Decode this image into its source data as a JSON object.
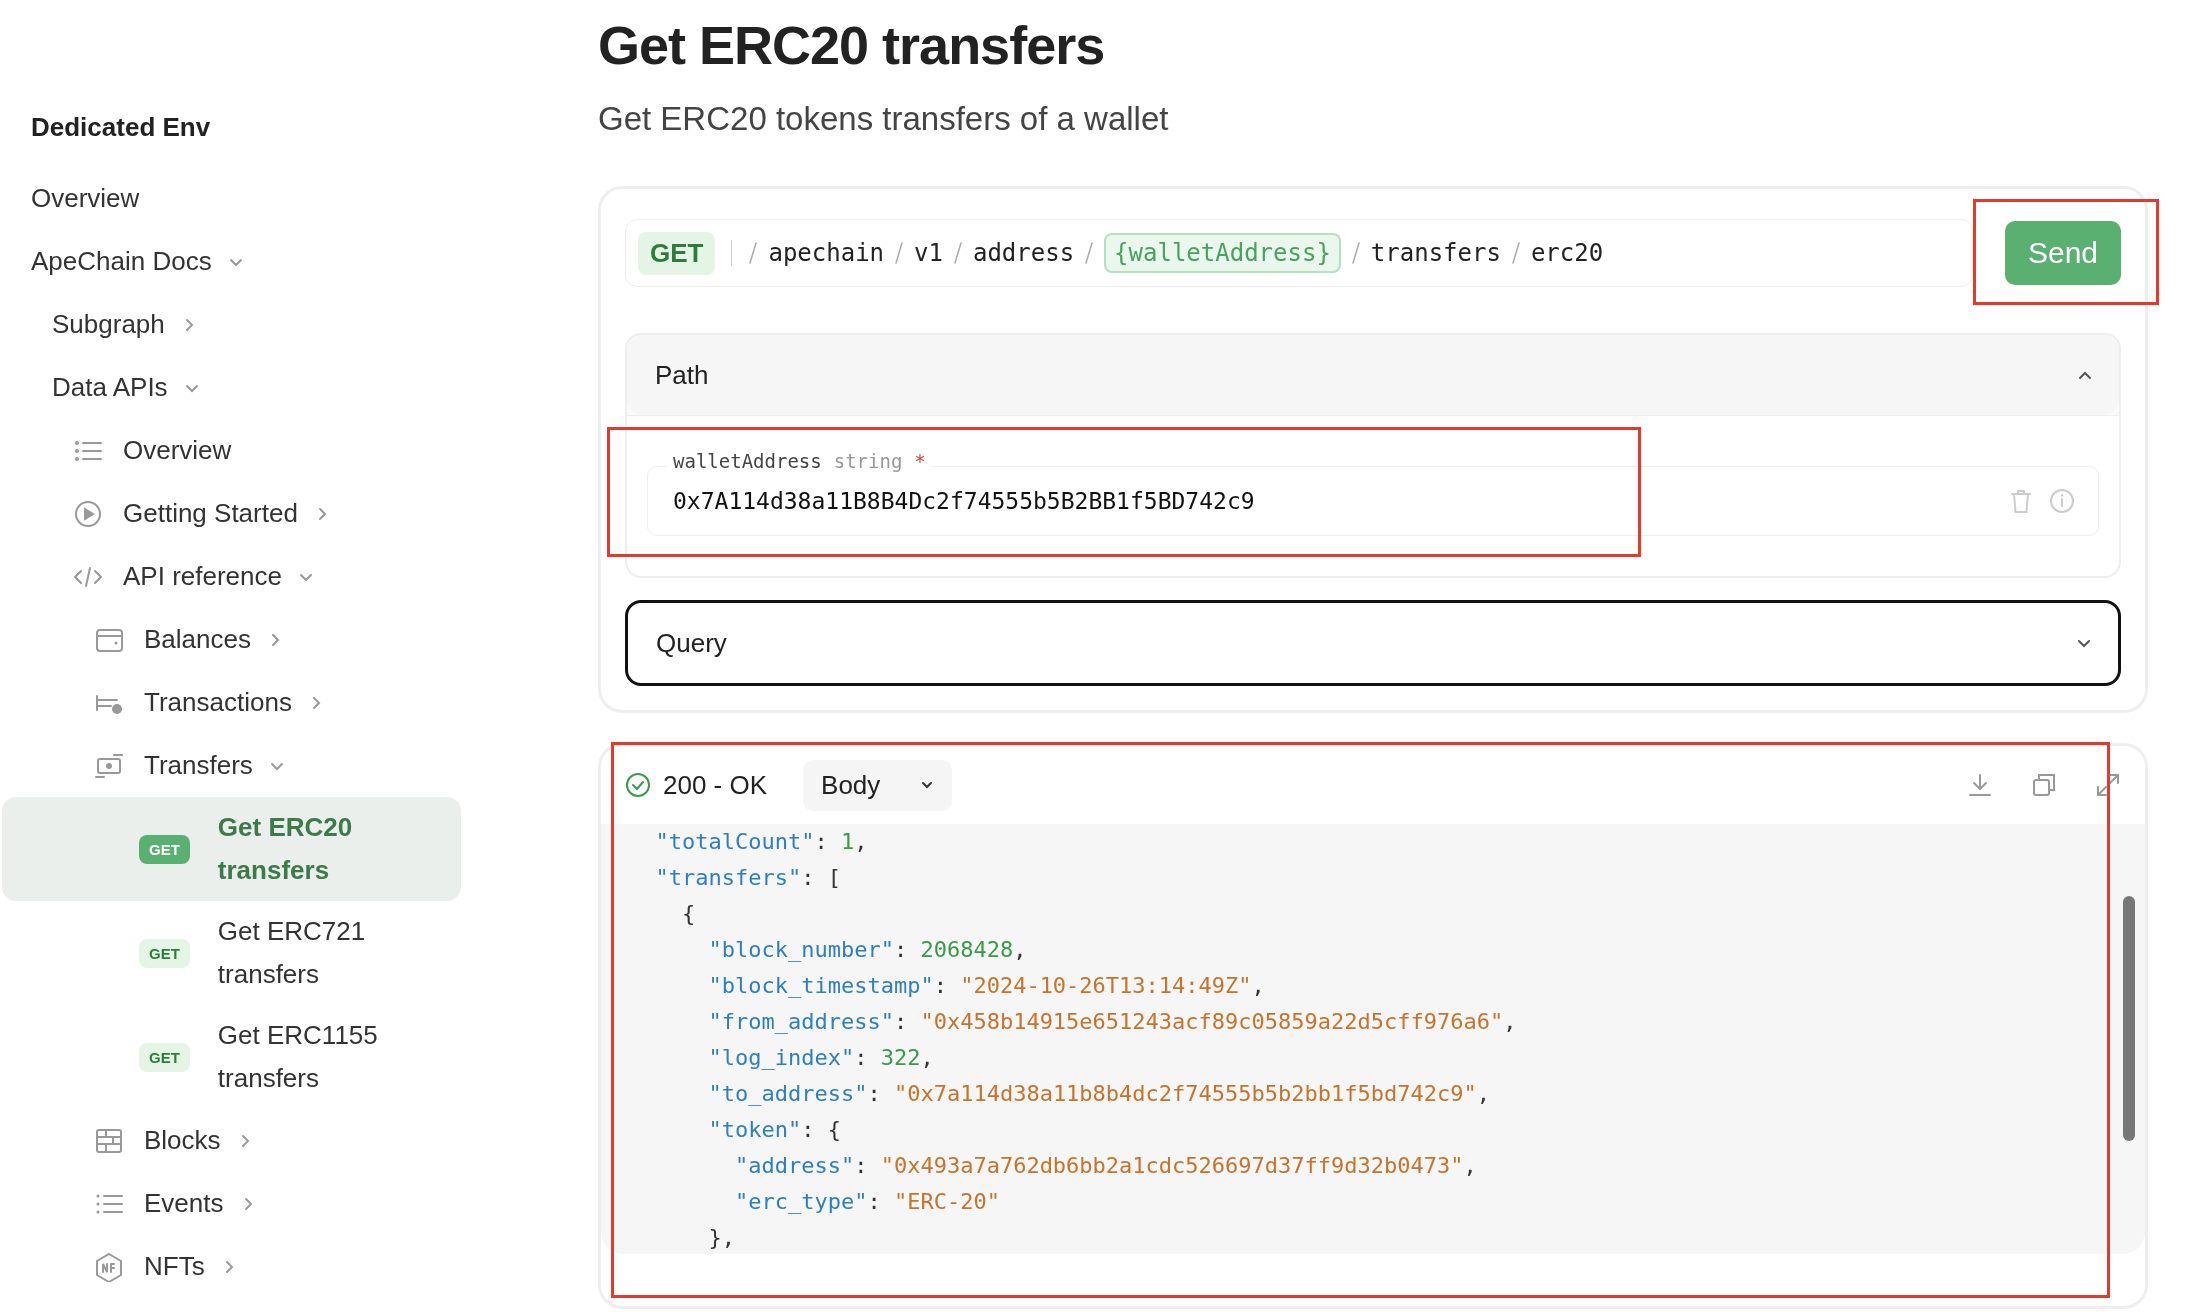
{
  "sidebar": {
    "heading": "Dedicated Env",
    "items": [
      {
        "label": "Overview"
      },
      {
        "label": "ApeChain Docs",
        "expanded": true,
        "children": [
          {
            "label": "Subgraph",
            "expanded": false
          },
          {
            "label": "Data APIs",
            "expanded": true,
            "children": [
              {
                "label": "Overview"
              },
              {
                "label": "Getting Started",
                "expanded": false
              },
              {
                "label": "API reference",
                "expanded": true,
                "children": [
                  {
                    "label": "Balances",
                    "expanded": false
                  },
                  {
                    "label": "Transactions",
                    "expanded": false
                  },
                  {
                    "label": "Transfers",
                    "expanded": true,
                    "children": [
                      {
                        "label": "Get ERC20 transfers",
                        "method": "GET",
                        "selected": true
                      },
                      {
                        "label": "Get ERC721 transfers",
                        "method": "GET",
                        "selected": false
                      },
                      {
                        "label": "Get ERC1155 transfers",
                        "method": "GET",
                        "selected": false
                      }
                    ]
                  },
                  {
                    "label": "Blocks",
                    "expanded": false
                  },
                  {
                    "label": "Events",
                    "expanded": false
                  },
                  {
                    "label": "NFTs",
                    "expanded": false
                  }
                ]
              }
            ]
          }
        ]
      }
    ]
  },
  "page": {
    "title": "Get ERC20 transfers",
    "subtitle": "Get ERC20 tokens transfers of a wallet"
  },
  "request": {
    "method": "GET",
    "path": [
      {
        "text": "apechain",
        "param": false
      },
      {
        "text": "v1",
        "param": false
      },
      {
        "text": "address",
        "param": false
      },
      {
        "text": "{walletAddress}",
        "param": true
      },
      {
        "text": "transfers",
        "param": false
      },
      {
        "text": "erc20",
        "param": false
      }
    ],
    "send": {
      "label": "Send",
      "highlighted": true
    },
    "sections": [
      {
        "title": "Path",
        "expanded": true,
        "focused": false,
        "params": [
          {
            "name": "walletAddress",
            "type": "string",
            "required_mark": "*",
            "value": "0x7A114d38a11B8B4Dc2f74555b5B2BB1f5BD742c9",
            "highlighted": true
          }
        ]
      },
      {
        "title": "Query",
        "expanded": false,
        "focused": true
      }
    ]
  },
  "response": {
    "status": "200 - OK",
    "view": "Body",
    "highlighted": true,
    "lines": [
      "  \"totalCount\": 1,",
      "  \"transfers\": [",
      "    {",
      "      \"block_number\": 2068428,",
      "      \"block_timestamp\": \"2024-10-26T13:14:49Z\",",
      "      \"from_address\": \"0x458b14915e651243acf89c05859a22d5cff976a6\",",
      "      \"log_index\": 322,",
      "      \"to_address\": \"0x7a114d38a11b8b4dc2f74555b5b2bb1f5bd742c9\",",
      "      \"token\": {",
      "        \"address\": \"0x493a7a762db6bb2a1cdc526697d37ff9d32b0473\",",
      "        \"erc_type\": \"ERC-20\"",
      "      },"
    ]
  }
}
